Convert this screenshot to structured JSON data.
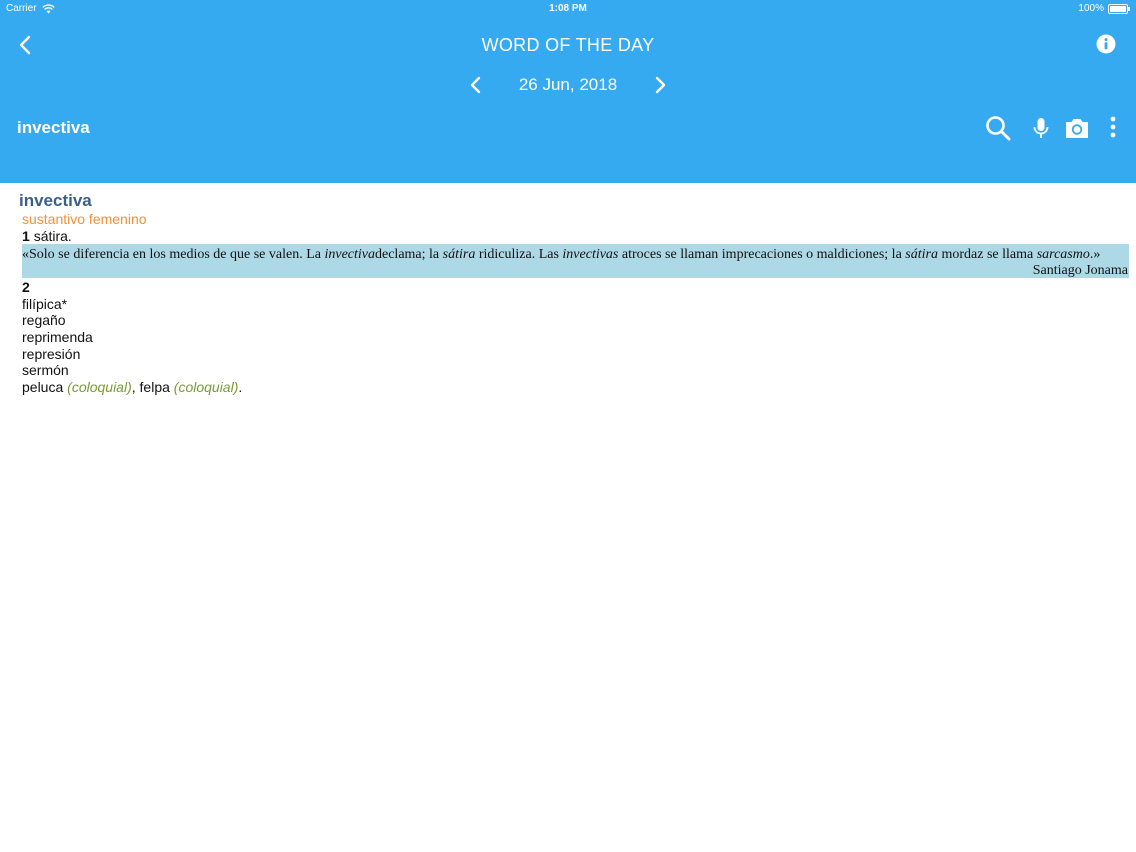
{
  "status_bar": {
    "carrier": "Carrier",
    "time": "1:08 PM",
    "battery": "100%"
  },
  "nav": {
    "title": "WORD OF THE DAY",
    "date": "26 Jun, 2018"
  },
  "search_bar": {
    "word": "invectiva"
  },
  "entry": {
    "headword": "invectiva",
    "pos": "sustantivo femenino",
    "sense1_number": "1",
    "sense1_text": "sátira.",
    "quote": {
      "p1": "«Solo se diferencia en los medios de que se valen. La ",
      "i1": "invectiva",
      "p2": "declama; la ",
      "i2": "sátira",
      "p3": " ridiculiza. Las ",
      "i3": "invectivas",
      "p4": " atroces se llaman imprecaciones o maldiciones; la ",
      "i4": "sátira",
      "p5": " mordaz se llama ",
      "i5": "sarcasmo",
      "p6": ".»",
      "author": "Santiago Jonama"
    },
    "sense2_number": "2",
    "synonyms": [
      "filípica*",
      "regaño",
      "reprimenda",
      "represión",
      "sermón"
    ],
    "last_line": {
      "w1": "peluca",
      "t1": "(coloquial)",
      "sep": ", ",
      "w2": "felpa",
      "t2": "(coloquial)",
      "end": "."
    }
  },
  "colors": {
    "header": "#35aaf0",
    "headword": "#3a5f8a",
    "pos": "#f0913a",
    "quote_bg": "#add8e6",
    "colloquial": "#7a9a3a"
  },
  "icons": [
    "wifi-icon",
    "battery-icon",
    "back-chevron-icon",
    "info-icon",
    "chevron-left-icon",
    "chevron-right-icon",
    "search-icon",
    "microphone-icon",
    "camera-icon",
    "more-vertical-icon"
  ]
}
